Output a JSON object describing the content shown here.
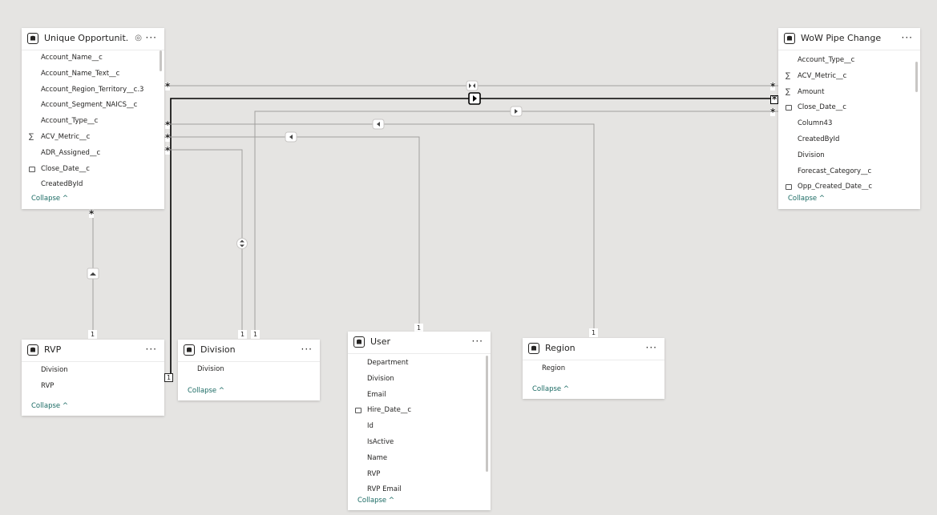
{
  "tables": {
    "unique": {
      "title": "Unique Opportunit...",
      "fields": [
        {
          "name": "Account_Name__c",
          "icon": ""
        },
        {
          "name": "Account_Name_Text__c",
          "icon": ""
        },
        {
          "name": "Account_Region_Territory__c.3",
          "icon": ""
        },
        {
          "name": "Account_Segment_NAICS__c",
          "icon": ""
        },
        {
          "name": "Account_Type__c",
          "icon": ""
        },
        {
          "name": "ACV_Metric__c",
          "icon": "sigma"
        },
        {
          "name": "ADR_Assigned__c",
          "icon": ""
        },
        {
          "name": "Close_Date__c",
          "icon": "calendar"
        },
        {
          "name": "CreatedById",
          "icon": ""
        }
      ],
      "collapse": "Collapse ^"
    },
    "wow": {
      "title": "WoW Pipe Change",
      "fields": [
        {
          "name": "Account_Type__c",
          "icon": ""
        },
        {
          "name": "ACV_Metric__c",
          "icon": "sigma"
        },
        {
          "name": "Amount",
          "icon": "sigma"
        },
        {
          "name": "Close_Date__c",
          "icon": "calendar"
        },
        {
          "name": "Column43",
          "icon": ""
        },
        {
          "name": "CreatedById",
          "icon": ""
        },
        {
          "name": "Division",
          "icon": ""
        },
        {
          "name": "Forecast_Category__c",
          "icon": ""
        },
        {
          "name": "Opp_Created_Date__c",
          "icon": "calendar"
        }
      ],
      "collapse": "Collapse ^"
    },
    "rvp": {
      "title": "RVP",
      "fields": [
        {
          "name": "Division",
          "icon": ""
        },
        {
          "name": "RVP",
          "icon": ""
        }
      ],
      "collapse": "Collapse ^"
    },
    "division": {
      "title": "Division",
      "fields": [
        {
          "name": "Division",
          "icon": ""
        }
      ],
      "collapse": "Collapse ^"
    },
    "user": {
      "title": "User",
      "fields": [
        {
          "name": "Department",
          "icon": ""
        },
        {
          "name": "Division",
          "icon": ""
        },
        {
          "name": "Email",
          "icon": ""
        },
        {
          "name": "Hire_Date__c",
          "icon": "calendar"
        },
        {
          "name": "Id",
          "icon": ""
        },
        {
          "name": "IsActive",
          "icon": ""
        },
        {
          "name": "Name",
          "icon": ""
        },
        {
          "name": "RVP",
          "icon": ""
        },
        {
          "name": "RVP Email",
          "icon": ""
        }
      ],
      "collapse": "Collapse ^"
    },
    "region": {
      "title": "Region",
      "fields": [
        {
          "name": "Region",
          "icon": ""
        }
      ],
      "collapse": "Collapse ^"
    }
  },
  "cardinality": {
    "many": "*",
    "one": "1"
  },
  "icons": {
    "table": "table-icon",
    "more": "more-options-icon",
    "hidden": "eye-icon"
  },
  "more_label": "···",
  "colors": {
    "accent": "#1a6a63",
    "line": "#8a8886",
    "active_line": "#000000",
    "canvas": "#e5e4e2"
  }
}
